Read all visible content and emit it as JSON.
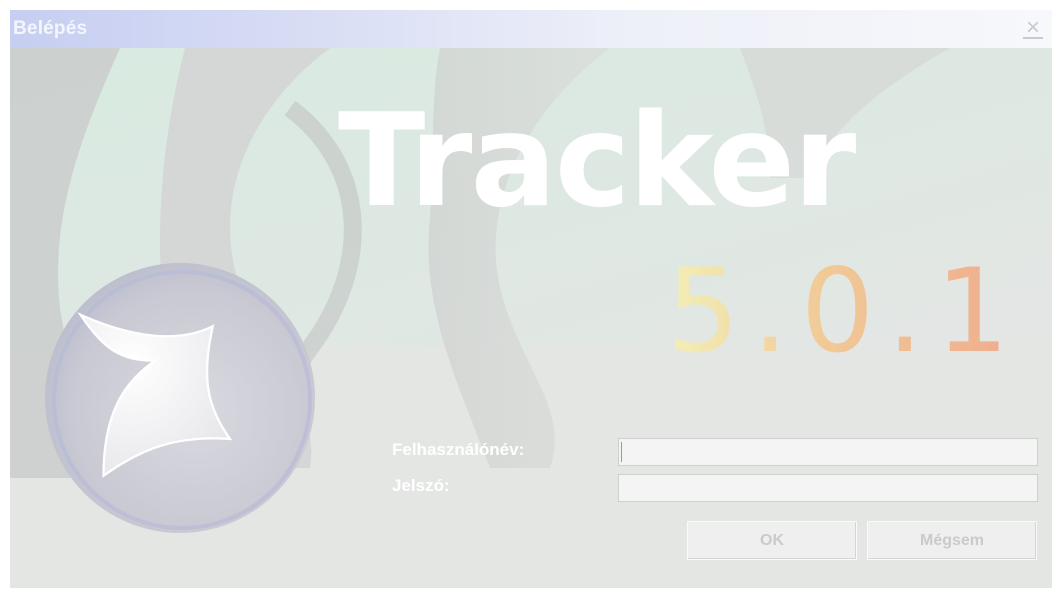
{
  "window": {
    "title": "Belépés",
    "close_icon": "close-icon"
  },
  "branding": {
    "product_name": "Tracker",
    "version": "5.0.1",
    "logo_icon": "star-swirl-logo-icon"
  },
  "form": {
    "username_label": "Felhasználónév:",
    "username_value": "",
    "password_label": "Jelszó:",
    "password_value": ""
  },
  "buttons": {
    "ok_label": "OK",
    "cancel_label": "Mégsem"
  },
  "colors": {
    "titlebar_start": "#c6cef1",
    "window_background": "#e4e6e4",
    "version_gradient_start": "#f3efb8",
    "version_gradient_end": "#efac8e"
  }
}
